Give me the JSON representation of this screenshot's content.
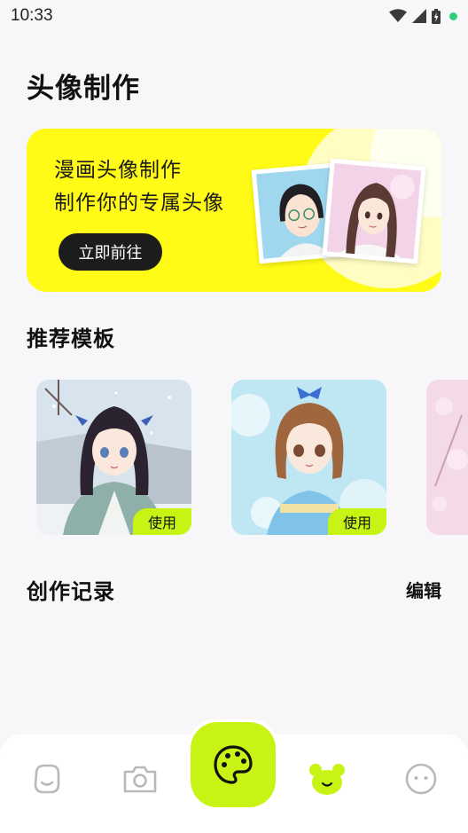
{
  "status_bar": {
    "time": "10:33",
    "icons": [
      "wifi-icon",
      "signal-icon",
      "battery-icon"
    ],
    "dot_color": "#2fd07a"
  },
  "page_title": "头像制作",
  "banner": {
    "line1": "漫画头像制作",
    "line2": "制作你的专属头像",
    "button_label": "立即前往",
    "background": "#fffb16"
  },
  "recommend": {
    "title": "推荐模板",
    "templates": [
      {
        "use_label": "使用",
        "theme": "snow-scene-girl"
      },
      {
        "use_label": "使用",
        "theme": "summer-girl-blue-bow"
      },
      {
        "theme": "cherry-blossom"
      }
    ]
  },
  "history": {
    "title": "创作记录",
    "edit_label": "编辑"
  },
  "tab_bar": {
    "tabs": [
      {
        "icon": "face-smile-icon"
      },
      {
        "icon": "camera-icon"
      },
      {
        "icon": "palette-icon",
        "active": true
      },
      {
        "icon": "bear-icon"
      },
      {
        "icon": "face-neutral-icon"
      }
    ],
    "accent": "#c8f415"
  }
}
